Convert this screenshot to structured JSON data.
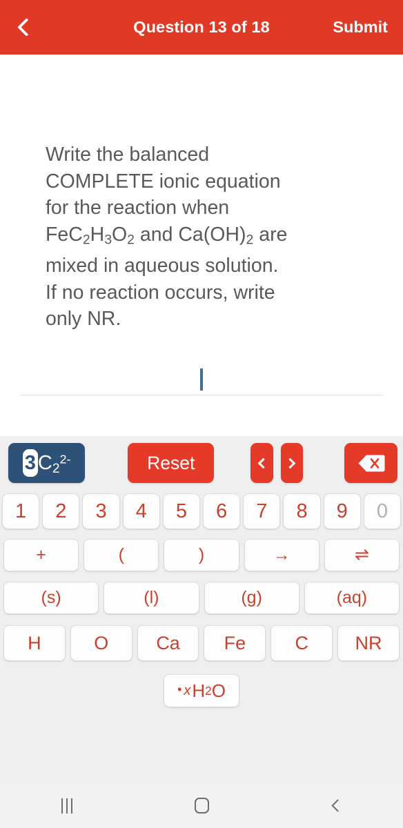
{
  "header": {
    "back_icon": "chevron-left-icon",
    "title": "Question 13 of 18",
    "submit_label": "Submit"
  },
  "question": {
    "line1": "Write the balanced",
    "line2": "COMPLETE ionic equation",
    "line3": "for the reaction when",
    "line4_a": "FeC",
    "line4_sub1": "2",
    "line4_b": "H",
    "line4_sub2": "3",
    "line4_c": "O",
    "line4_sub3": "2",
    "line4_d": " and Ca(OH)",
    "line4_sub4": "2",
    "line4_e": " are",
    "line5": "mixed in aqueous solution.",
    "line6": "If no reaction occurs, write",
    "line7": "only NR."
  },
  "answer": {
    "value": "",
    "caret_visible": true
  },
  "keyboard": {
    "token": {
      "selected": "3",
      "element": "C",
      "subscript": "2",
      "charge": "2-"
    },
    "reset_label": "Reset",
    "cursor_left_icon": "chevron-left-icon",
    "cursor_right_icon": "chevron-right-icon",
    "backspace_icon": "backspace-icon",
    "digits": [
      {
        "label": "1",
        "disabled": false
      },
      {
        "label": "2",
        "disabled": false
      },
      {
        "label": "3",
        "disabled": false
      },
      {
        "label": "4",
        "disabled": false
      },
      {
        "label": "5",
        "disabled": false
      },
      {
        "label": "6",
        "disabled": false
      },
      {
        "label": "7",
        "disabled": false
      },
      {
        "label": "8",
        "disabled": false
      },
      {
        "label": "9",
        "disabled": false
      },
      {
        "label": "0",
        "disabled": true
      }
    ],
    "operators": [
      "+",
      "(",
      ")",
      "→",
      "⇌"
    ],
    "states": [
      "(s)",
      "(l)",
      "(g)",
      "(aq)"
    ],
    "elements": [
      "H",
      "O",
      "Ca",
      "Fe",
      "C",
      "NR"
    ],
    "hydrate": {
      "dot": "•",
      "variable": "x",
      "formula": "H",
      "subscript": "2",
      "formula_end": "O"
    }
  },
  "navbar": {
    "recents_icon": "recents-icon",
    "home_icon": "home-icon",
    "back_icon": "back-icon"
  },
  "colors": {
    "header_red": "#E03A27",
    "key_red": "#E53A28",
    "key_text_red": "#C9402E",
    "token_navy": "#2E5277",
    "caret_blue": "#3D7099",
    "keyboard_bg": "#EFEFEF",
    "question_text": "#58595B",
    "disabled_grey": "#B0B0B0"
  }
}
